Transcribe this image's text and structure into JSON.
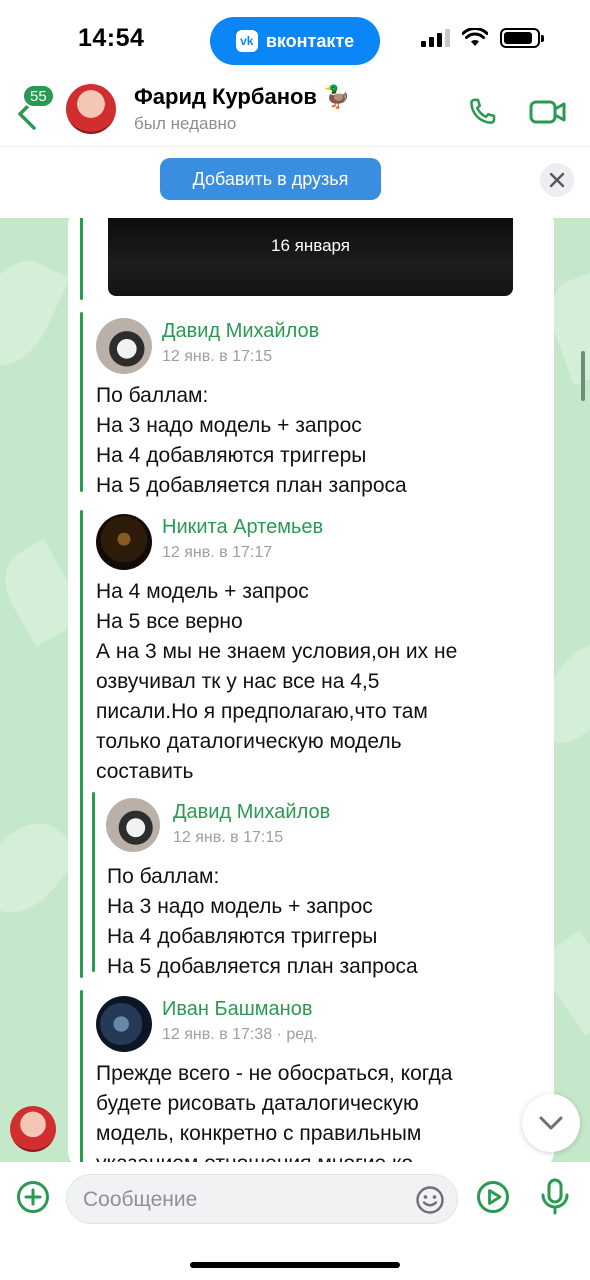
{
  "status_bar": {
    "time": "14:54",
    "app_pill": "вконтакте",
    "app_pill_logo": "vk",
    "icons": [
      "signal-icon",
      "wifi-icon",
      "battery-icon"
    ]
  },
  "header": {
    "unread_badge": "55",
    "contact_name": "Фарид Курбанов 🦆",
    "contact_status": "был недавно",
    "icons": [
      "back-arrow-icon",
      "phone-icon",
      "video-camera-icon"
    ]
  },
  "friend_bar": {
    "add_friend_label": "Добавить в друзья",
    "close_icon": "close-icon"
  },
  "chat": {
    "photo_date": "16 января",
    "forwarded": [
      {
        "author": "Давид Михайлов",
        "time": "12 янв. в 17:15",
        "lines": [
          "По баллам:",
          "На 3 надо модель + запрос",
          "На 4 добавляются триггеры",
          "На 5 добавляется план запроса"
        ]
      },
      {
        "author": "Никита Артемьев",
        "time": "12 янв. в 17:17",
        "lines": [
          "На 4 модель + запрос",
          "На 5 все верно",
          "А на 3 мы не знаем условия,он их не",
          "озвучивал тк у нас все на 4,5",
          "писали.Но я предполагаю,что там",
          "только даталогическую модель",
          "составить"
        ],
        "quoted": {
          "author": "Давид Михайлов",
          "time": "12 янв. в 17:15",
          "lines": [
            "По баллам:",
            "На 3 надо модель + запрос",
            "На 4 добавляются триггеры",
            "На 5 добавляется план запроса"
          ]
        }
      },
      {
        "author": "Иван Башманов",
        "time": "12 янв. в 17:38 · ред.",
        "lines": [
          "Прежде всего - не обосраться, когда",
          "будете рисовать даталогическую",
          "модель, конкретно с правильным",
          "указанием отношения многие ко"
        ]
      }
    ],
    "scroll_down_icon": "chevron-down-icon"
  },
  "composer": {
    "placeholder": "Сообщение",
    "icons": [
      "plus-circle-icon",
      "emoji-icon",
      "play-circle-icon",
      "microphone-icon"
    ]
  },
  "colors": {
    "accent_green": "#2a9a52",
    "button_blue": "#3a8ee0",
    "vk_blue": "#0a86f6",
    "chat_background": "#c4e8c9"
  }
}
